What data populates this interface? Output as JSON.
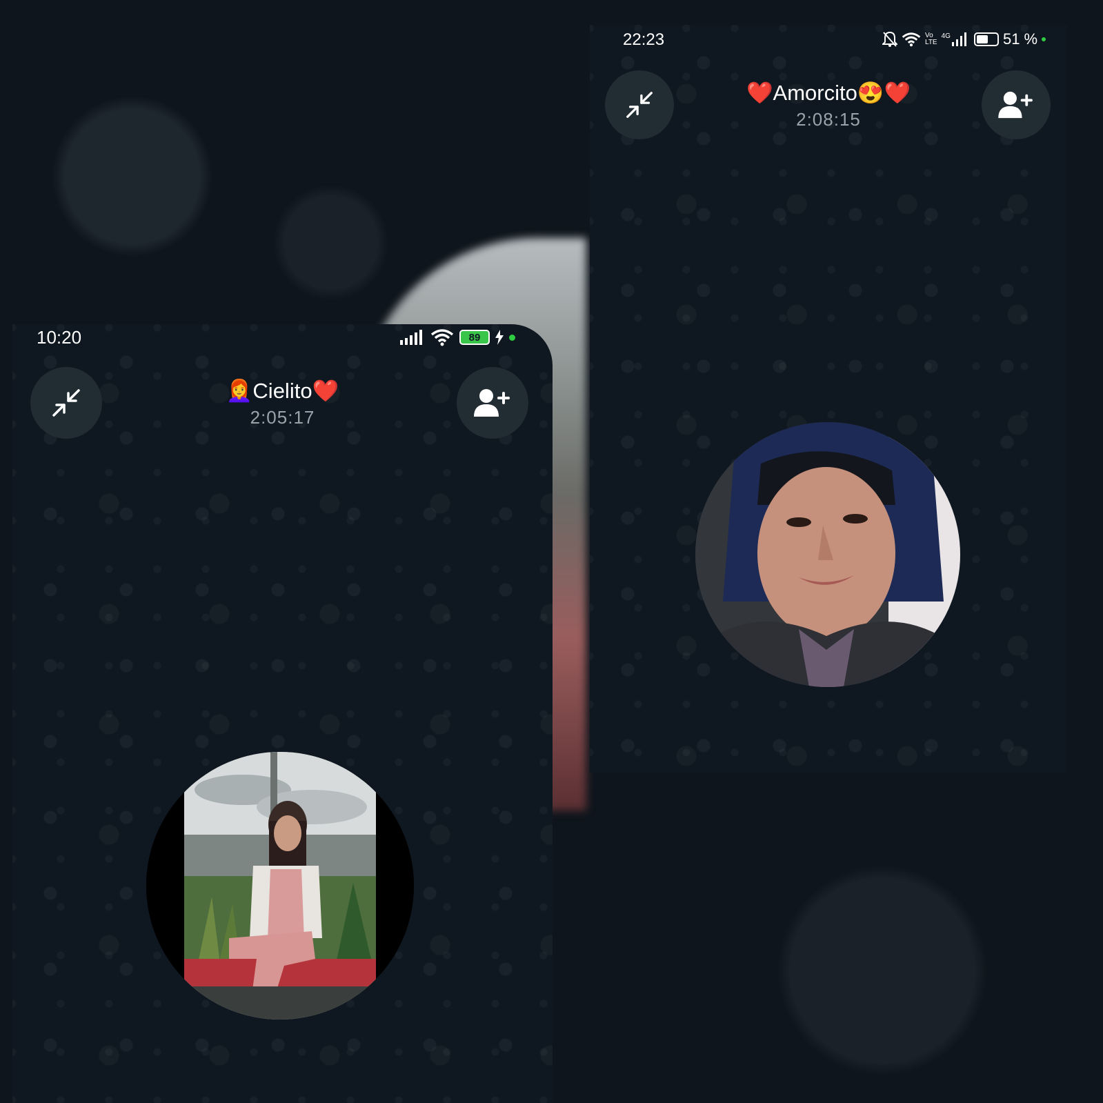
{
  "left_call": {
    "status_time": "10:20",
    "battery_level": "89",
    "contact_name": "Cielito❤️",
    "contact_prefix_emoji": "👩‍🦰",
    "call_duration": "2:05:17"
  },
  "right_call": {
    "status_time": "22:23",
    "network_label_vo": "Vo",
    "network_label_lte": "LTE",
    "network_label_4g": "4G",
    "battery_percent": "51 %",
    "contact_name": "❤️Amorcito😍❤️",
    "call_duration": "2:08:15"
  },
  "icons": {
    "minimize": "minimize-arrows-icon",
    "add_participant": "add-person-icon",
    "signal": "signal-icon",
    "wifi": "wifi-icon",
    "battery": "battery-icon",
    "charging": "bolt-icon",
    "mute_notifications": "bell-off-icon"
  },
  "colors": {
    "panel_bg": "#0f1820",
    "button_bg": "#222c33",
    "battery_green": "#39c44a",
    "status_dot_green": "#2ecc40",
    "timer_gray": "#9aa3aa"
  }
}
